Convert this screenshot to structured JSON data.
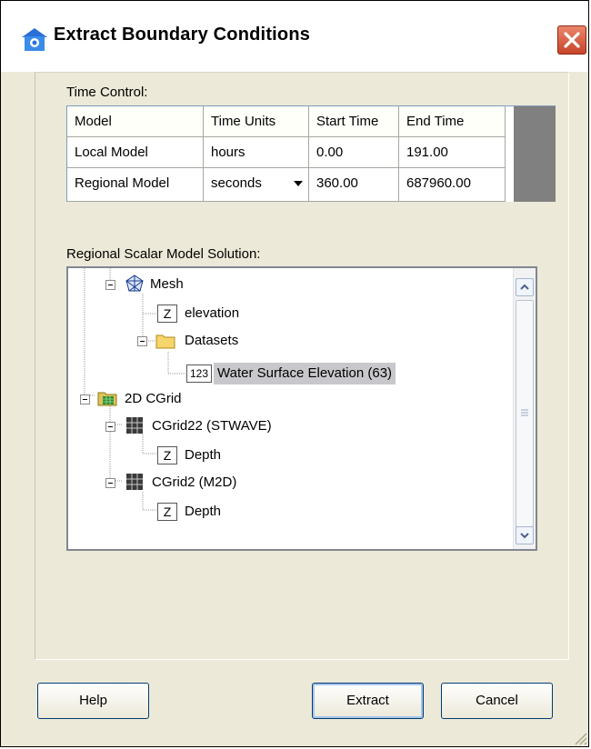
{
  "window": {
    "title": "Extract Boundary Conditions"
  },
  "time_control": {
    "label": "Time Control:",
    "columns": [
      "Model",
      "Time Units",
      "Start Time",
      "End Time"
    ],
    "rows": [
      {
        "model": "Local Model",
        "units": "hours",
        "start": "0.00",
        "end": "191.00"
      },
      {
        "model": "Regional Model",
        "units": "seconds",
        "start": "360.00",
        "end": "687960.00"
      }
    ]
  },
  "regional": {
    "label": "Regional Scalar Model Solution:",
    "tree": {
      "mesh": "Mesh",
      "elevation": "elevation",
      "datasets": "Datasets",
      "wse": "Water Surface Elevation (63)",
      "wse_icon": "123",
      "cgrid": "2D CGrid",
      "cgrid22": "CGrid22 (STWAVE)",
      "depth1": "Depth",
      "cgrid2": "CGrid2 (M2D)",
      "depth2": "Depth",
      "z": "Z"
    }
  },
  "buttons": {
    "help": "Help",
    "extract": "Extract",
    "cancel": "Cancel"
  },
  "icons": {
    "app": "app-icon",
    "close": "close-icon",
    "mesh": "mesh-icon",
    "folder": "folder-icon",
    "grid": "grid-icon",
    "cgrid": "cgrid-icon"
  },
  "colors": {
    "window_bg": "#ece9d8",
    "close_red": "#c8442a",
    "selection": "#c8c8cc"
  }
}
